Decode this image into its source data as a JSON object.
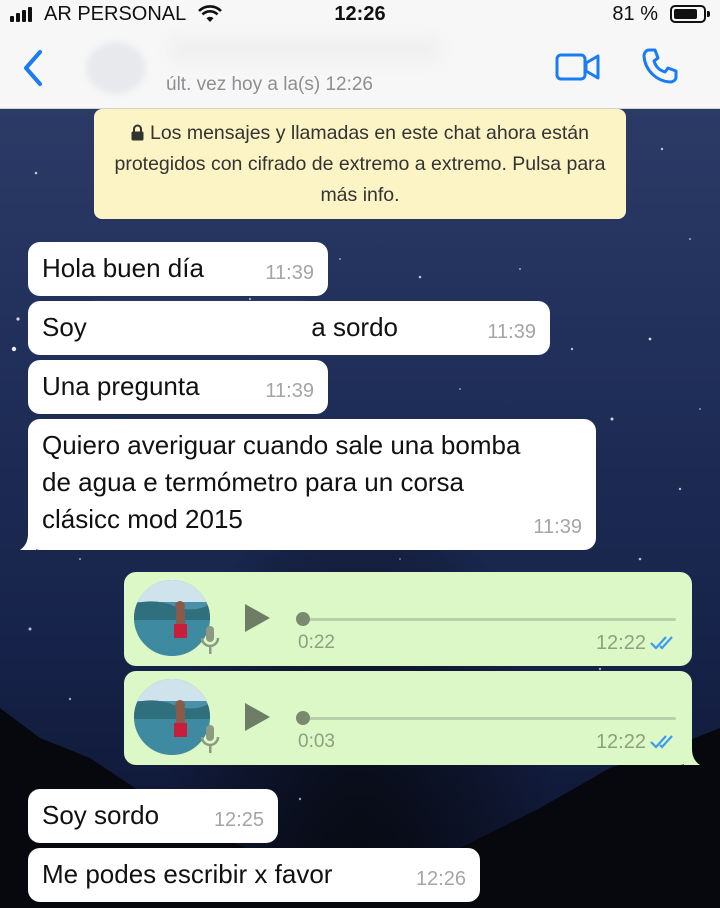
{
  "status": {
    "carrier": "AR PERSONAL",
    "time": "12:26",
    "battery": "81 %",
    "battery_level": 0.81
  },
  "header": {
    "last_seen": "últ. vez hoy a la(s) 12:26"
  },
  "notice": {
    "text": "Los mensajes y llamadas en este chat ahora están protegidos con cifrado de extremo a extremo. Pulsa para más info."
  },
  "messages": [
    {
      "text": "Hola buen día",
      "time": "11:39"
    },
    {
      "text_start": "Soy",
      "text_end": "a sordo",
      "time": "11:39"
    },
    {
      "text": "Una pregunta",
      "time": "11:39"
    },
    {
      "text": "Quiero averiguar cuando sale una bomba de agua e termómetro para un corsa clásicc mod 2015",
      "time": "11:39"
    },
    {
      "text": "Soy sordo",
      "time": "12:25"
    },
    {
      "text": "Me podes escribir x favor",
      "time": "12:26"
    }
  ],
  "audio": [
    {
      "duration": "0:22",
      "time": "12:22"
    },
    {
      "duration": "0:03",
      "time": "12:22"
    }
  ],
  "colors": {
    "accent": "#1a7cf5",
    "outgoing": "#dcf8c6",
    "incoming": "#ffffff",
    "notice": "#fdf4c5",
    "read_ticks": "#3b9cf0"
  },
  "icons": [
    "back-chevron",
    "video-call",
    "phone-call",
    "lock",
    "play",
    "microphone",
    "double-check"
  ]
}
